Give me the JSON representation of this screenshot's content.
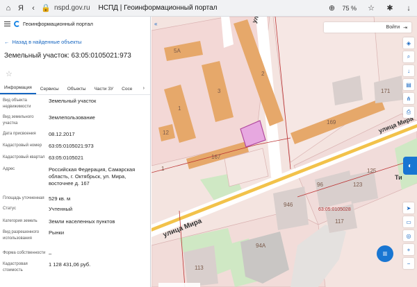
{
  "browser": {
    "url": "nspd.gov.ru",
    "tab_title": "НСПД | Геоинформационный портал",
    "zoom": "75 %"
  },
  "portal": {
    "title": "Геоинформационный портал"
  },
  "panel": {
    "back_label": "Назад в найденные объекты",
    "object_title": "Земельный участок: 63:05:0105021:973",
    "tabs": [
      "Информация",
      "Сервисы",
      "Объекты",
      "Части ЗУ",
      "Сосе"
    ],
    "rows": [
      {
        "label": "Вид объекта недвижимости",
        "value": "Земельный участок"
      },
      {
        "label": "Вид земельного участка",
        "value": "Землепользование"
      },
      {
        "label": "Дата присвоения",
        "value": "08.12.2017"
      },
      {
        "label": "Кадастровый номер",
        "value": "63:05:0105021:973"
      },
      {
        "label": "Кадастровый квартал",
        "value": "63:05:0105021"
      },
      {
        "label": "Адрес",
        "value": "Российская Федерация, Самарская область, г. Октябрьск, ул. Мира, восточнее д. 167"
      },
      {
        "label": "Площадь уточненная",
        "value": "529 кв. м"
      },
      {
        "label": "Статус",
        "value": "Учтенный"
      },
      {
        "label": "Категория земель",
        "value": "Земли населенных пунктов"
      },
      {
        "label": "Вид разрешенного использования",
        "value": "Рынки"
      },
      {
        "label": "Форма собственности",
        "value": "–"
      },
      {
        "label": "Кадастровая стоимость",
        "value": "1 128 431,06 руб."
      }
    ]
  },
  "map": {
    "login_label": "Войти",
    "street_labels": [
      "улица Мира",
      "улица Мичурина",
      "улица Мира"
    ],
    "building_labels": [
      "5А",
      "1",
      "3",
      "2",
      "167",
      "169",
      "171",
      "12",
      "96",
      "123",
      "125",
      "946",
      "117",
      "94А",
      "113",
      "1",
      "Ти"
    ],
    "parcel_label": "63:05:0105028",
    "selected_parcel_color": "#e7a8e0",
    "accent_color": "#1976d2"
  }
}
